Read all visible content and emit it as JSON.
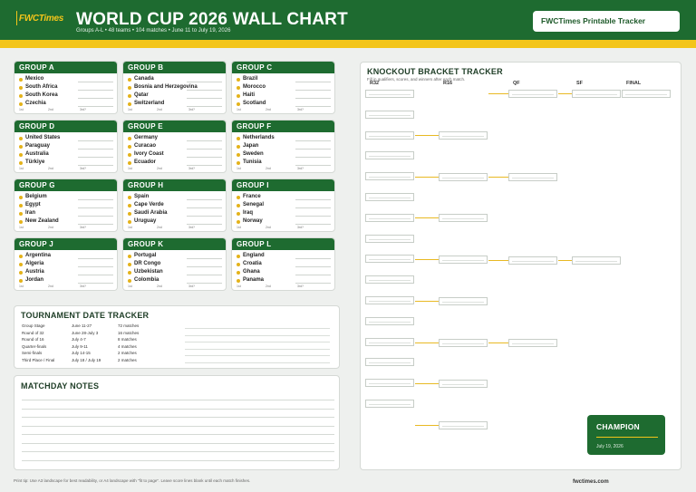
{
  "header": {
    "logo_main": "FWC",
    "logo_accent": "Times",
    "title": "WORLD CUP 2026 WALL CHART",
    "subtitle": "Groups A-L • 48 teams • 104 matches • June 11 to July 19, 2026",
    "tracker_label": "FWCTimes Printable Tracker"
  },
  "place_labels": [
    "1st",
    "2nd",
    "3rd?"
  ],
  "groups": [
    {
      "name": "GROUP A",
      "teams": [
        "Mexico",
        "South Africa",
        "South Korea",
        "Czechia"
      ]
    },
    {
      "name": "GROUP B",
      "teams": [
        "Canada",
        "Bosnia and Herzegovina",
        "Qatar",
        "Switzerland"
      ]
    },
    {
      "name": "GROUP C",
      "teams": [
        "Brazil",
        "Morocco",
        "Haiti",
        "Scotland"
      ]
    },
    {
      "name": "GROUP D",
      "teams": [
        "United States",
        "Paraguay",
        "Australia",
        "Türkiye"
      ]
    },
    {
      "name": "GROUP E",
      "teams": [
        "Germany",
        "Curacao",
        "Ivory Coast",
        "Ecuador"
      ]
    },
    {
      "name": "GROUP F",
      "teams": [
        "Netherlands",
        "Japan",
        "Sweden",
        "Tunisia"
      ]
    },
    {
      "name": "GROUP G",
      "teams": [
        "Belgium",
        "Egypt",
        "Iran",
        "New Zealand"
      ]
    },
    {
      "name": "GROUP H",
      "teams": [
        "Spain",
        "Cape Verde",
        "Saudi Arabia",
        "Uruguay"
      ]
    },
    {
      "name": "GROUP I",
      "teams": [
        "France",
        "Senegal",
        "Iraq",
        "Norway"
      ]
    },
    {
      "name": "GROUP J",
      "teams": [
        "Argentina",
        "Algeria",
        "Austria",
        "Jordan"
      ]
    },
    {
      "name": "GROUP K",
      "teams": [
        "Portugal",
        "DR Congo",
        "Uzbekistan",
        "Colombia"
      ]
    },
    {
      "name": "GROUP L",
      "teams": [
        "England",
        "Croatia",
        "Ghana",
        "Panama"
      ]
    }
  ],
  "date_tracker": {
    "title": "TOURNAMENT DATE TRACKER",
    "rows": [
      {
        "stage": "Group Stage",
        "dates": "June 11-27",
        "matches": "72 matches"
      },
      {
        "stage": "Round of 32",
        "dates": "June 28-July 3",
        "matches": "16 matches"
      },
      {
        "stage": "Round of 16",
        "dates": "July 4-7",
        "matches": "8 matches"
      },
      {
        "stage": "Quarter-finals",
        "dates": "July 9-11",
        "matches": "4 matches"
      },
      {
        "stage": "Semi-finals",
        "dates": "July 14-15",
        "matches": "2 matches"
      },
      {
        "stage": "Third Place / Final",
        "dates": "July 18 / July 19",
        "matches": "2 matches"
      }
    ]
  },
  "notes": {
    "title": "MATCHDAY NOTES"
  },
  "bracket": {
    "title": "KNOCKOUT BRACKET TRACKER",
    "subtitle": "Fill in qualifiers, scores, and winners after each match.",
    "rounds": [
      "R32",
      "R16",
      "QF",
      "SF",
      "FINAL"
    ]
  },
  "champion": {
    "title": "CHAMPION",
    "date": "July 19, 2026"
  },
  "footer": {
    "note": "Print tip: Use A3 landscape for best readability, or A4 landscape with \"fit to page\". Leave score lines blank until each match finishes.",
    "site": "fwctimes.com"
  },
  "colors": {
    "primary_green": "#1e6b30",
    "accent_gold": "#f3c51a"
  }
}
